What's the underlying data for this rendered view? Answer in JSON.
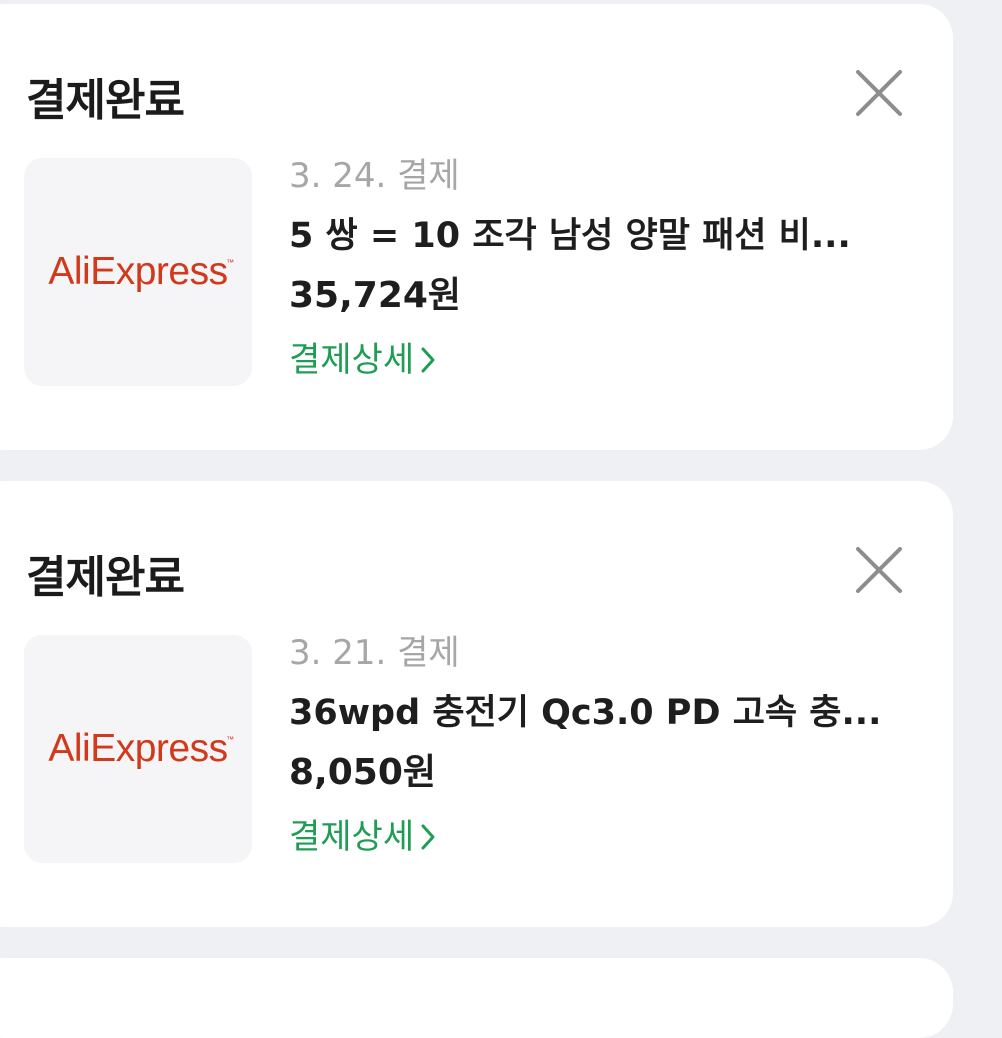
{
  "payments": [
    {
      "status": "결제완료",
      "merchant_logo": "AliExpress",
      "logo_mark": "™",
      "date": "3. 24. 결제",
      "title": "5 쌍 = 10 조각 남성 양말 패션 비...",
      "price": "35,724원",
      "detail_label": "결제상세"
    },
    {
      "status": "결제완료",
      "merchant_logo": "AliExpress",
      "logo_mark": "™",
      "date": "3. 21. 결제",
      "title": "36wpd 충전기 Qc3.0 PD 고속 충...",
      "price": "8,050원",
      "detail_label": "결제상세"
    }
  ],
  "icons": {
    "close": "close-icon",
    "chevron": "chevron-right-icon"
  },
  "colors": {
    "background": "#eef0f4",
    "card": "#ffffff",
    "link": "#1f9d55",
    "logo": "#d0391b",
    "muted": "#a6a6a6"
  }
}
